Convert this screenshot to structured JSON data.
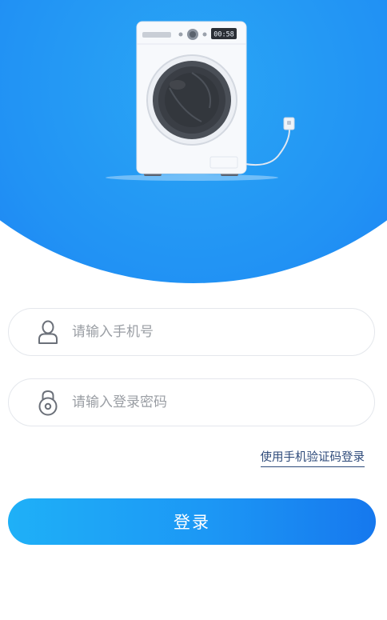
{
  "hero": {
    "washer_display": "00:58"
  },
  "form": {
    "phone_placeholder": "请输入手机号",
    "password_placeholder": "请输入登录密码",
    "sms_login_label": "使用手机验证码登录",
    "login_label": "登录"
  },
  "colors": {
    "primary": "#1c97f5",
    "hero_blue": "#2192f4",
    "link": "#2d4a7a",
    "placeholder": "#9a9ea4",
    "field_border": "#e4e7ec"
  },
  "icons": {
    "phone_field": "user-icon",
    "password_field": "lock-icon"
  }
}
